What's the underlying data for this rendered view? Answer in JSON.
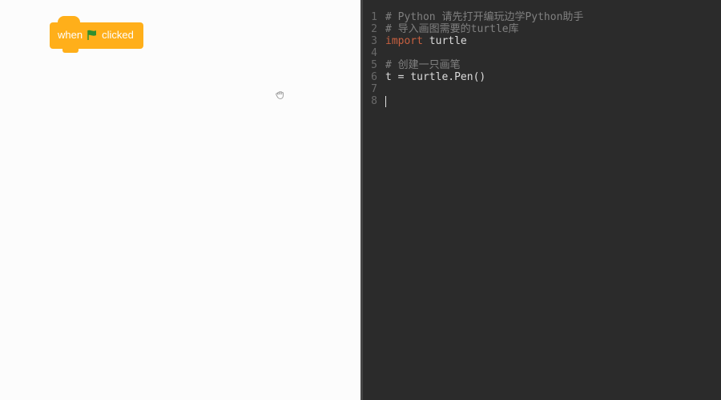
{
  "scratch": {
    "when_label": "when",
    "clicked_label": "clicked",
    "flag_color": "#2f8f2f"
  },
  "code": {
    "lines": [
      {
        "n": "1",
        "segments": [
          {
            "cls": "c-comment",
            "t": "# Python 请先打开编玩边学Python助手"
          }
        ]
      },
      {
        "n": "2",
        "segments": [
          {
            "cls": "c-comment",
            "t": "# 导入画图需要的turtle库"
          }
        ]
      },
      {
        "n": "3",
        "segments": [
          {
            "cls": "c-keyword",
            "t": "import"
          },
          {
            "cls": "c-plain",
            "t": " "
          },
          {
            "cls": "c-ident",
            "t": "turtle"
          }
        ]
      },
      {
        "n": "4",
        "segments": []
      },
      {
        "n": "5",
        "segments": [
          {
            "cls": "c-comment",
            "t": "# 创建一只画笔"
          }
        ]
      },
      {
        "n": "6",
        "segments": [
          {
            "cls": "c-ident",
            "t": "t"
          },
          {
            "cls": "c-plain",
            "t": " = turtle.Pen()"
          }
        ]
      },
      {
        "n": "7",
        "segments": []
      },
      {
        "n": "8",
        "segments": [],
        "caret": true
      }
    ]
  }
}
